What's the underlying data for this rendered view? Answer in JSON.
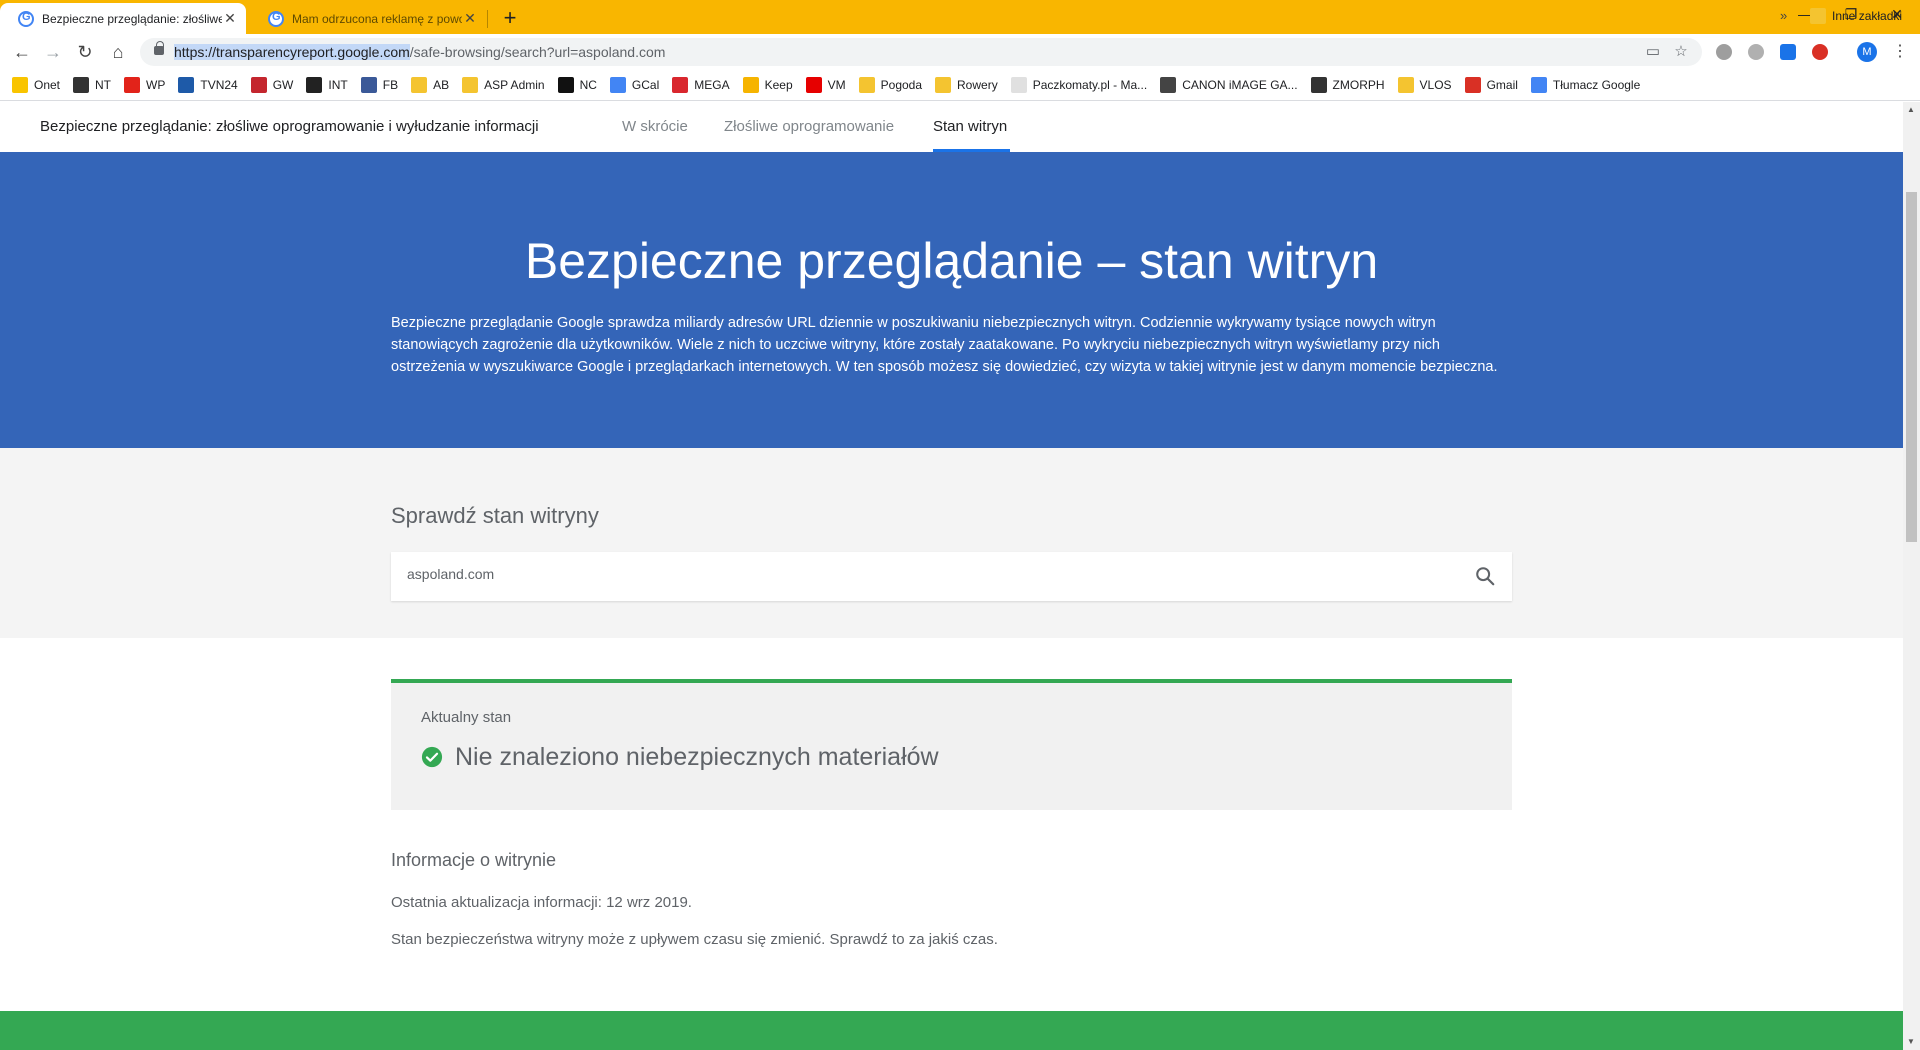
{
  "browser": {
    "tabs": [
      {
        "title": "Bezpieczne przeglądanie: złośliwe",
        "active": true
      },
      {
        "title": "Mam odrzucona reklamę z powo",
        "active": false
      }
    ],
    "new_tab_label": "+",
    "window_controls": {
      "minimize": "—",
      "restore": "❐",
      "close": "✕"
    },
    "url_host": "https://transparencyreport.google.com",
    "url_path": "/safe-browsing/search?url=aspoland.com",
    "avatar_letter": "M"
  },
  "bookmarks": [
    {
      "label": "Onet",
      "icon": "onet-icon",
      "color": "#f9c400"
    },
    {
      "label": "NT",
      "icon": "nt-icon",
      "color": "#333333"
    },
    {
      "label": "WP",
      "icon": "wp-icon",
      "color": "#e2231a"
    },
    {
      "label": "TVN24",
      "icon": "tvn24-icon",
      "color": "#1e5aa8"
    },
    {
      "label": "GW",
      "icon": "gw-icon",
      "color": "#c4262e"
    },
    {
      "label": "INT",
      "icon": "int-icon",
      "color": "#222222"
    },
    {
      "label": "FB",
      "icon": "facebook-icon",
      "color": "#3b5998"
    },
    {
      "label": "AB",
      "icon": "folder-icon",
      "color": "#f4c430"
    },
    {
      "label": "ASP Admin",
      "icon": "folder-icon",
      "color": "#f4c430"
    },
    {
      "label": "NC",
      "icon": "nc-icon",
      "color": "#111111"
    },
    {
      "label": "GCal",
      "icon": "gcal-icon",
      "color": "#4285f4"
    },
    {
      "label": "MEGA",
      "icon": "mega-icon",
      "color": "#d9272e"
    },
    {
      "label": "Keep",
      "icon": "keep-icon",
      "color": "#f6b400"
    },
    {
      "label": "VM",
      "icon": "vm-icon",
      "color": "#e60000"
    },
    {
      "label": "Pogoda",
      "icon": "folder-icon",
      "color": "#f4c430"
    },
    {
      "label": "Rowery",
      "icon": "folder-icon",
      "color": "#f4c430"
    },
    {
      "label": "Paczkomaty.pl - Ma...",
      "icon": "paczkomaty-icon",
      "color": "#e0e0e0"
    },
    {
      "label": "CANON iMAGE GA...",
      "icon": "canon-icon",
      "color": "#444444"
    },
    {
      "label": "ZMORPH",
      "icon": "zmorph-icon",
      "color": "#333333"
    },
    {
      "label": "VLOS",
      "icon": "folder-icon",
      "color": "#f4c430"
    },
    {
      "label": "Gmail",
      "icon": "gmail-icon",
      "color": "#d93025"
    },
    {
      "label": "Tłumacz Google",
      "icon": "translate-icon",
      "color": "#4285f4"
    }
  ],
  "bookmarks_more": "»",
  "bookmarks_other": "Inne zakładki",
  "page": {
    "nav_title": "Bezpieczne przeglądanie: złośliwe oprogramowanie i wyłudzanie informacji",
    "nav_tabs": [
      "W skrócie",
      "Złośliwe oprogramowanie",
      "Stan witryn"
    ],
    "hero_title": "Bezpieczne przeglądanie – stan witryn",
    "hero_text": "Bezpieczne przeglądanie Google sprawdza miliardy adresów URL dziennie w poszukiwaniu niebezpiecznych witryn. Codziennie wykrywamy tysiące nowych witryn stanowiących zagrożenie dla użytkowników. Wiele z nich to uczciwe witryny, które zostały zaatakowane. Po wykryciu niebezpiecznych witryn wyświetlamy przy nich ostrzeżenia w wyszukiwarce Google i przeglądarkach internetowych. W ten sposób możesz się dowiedzieć, czy wizyta w takiej witrynie jest w danym momencie bezpieczna.",
    "search_heading": "Sprawdź stan witryny",
    "search_value": "aspoland.com",
    "status_label": "Aktualny stan",
    "status_message": "Nie znaleziono niebezpiecznych materiałów",
    "info_heading": "Informacje o witrynie",
    "info_updated": "Ostatnia aktualizacja informacji: 12 wrz 2019.",
    "info_note": "Stan bezpieczeństwa witryny może z upływem czasu się zmienić. Sprawdź to za jakiś czas."
  },
  "colors": {
    "tabstrip": "#f9b600",
    "hero": "#3465b8",
    "status_ok": "#34a853",
    "accent": "#1a73e8"
  }
}
